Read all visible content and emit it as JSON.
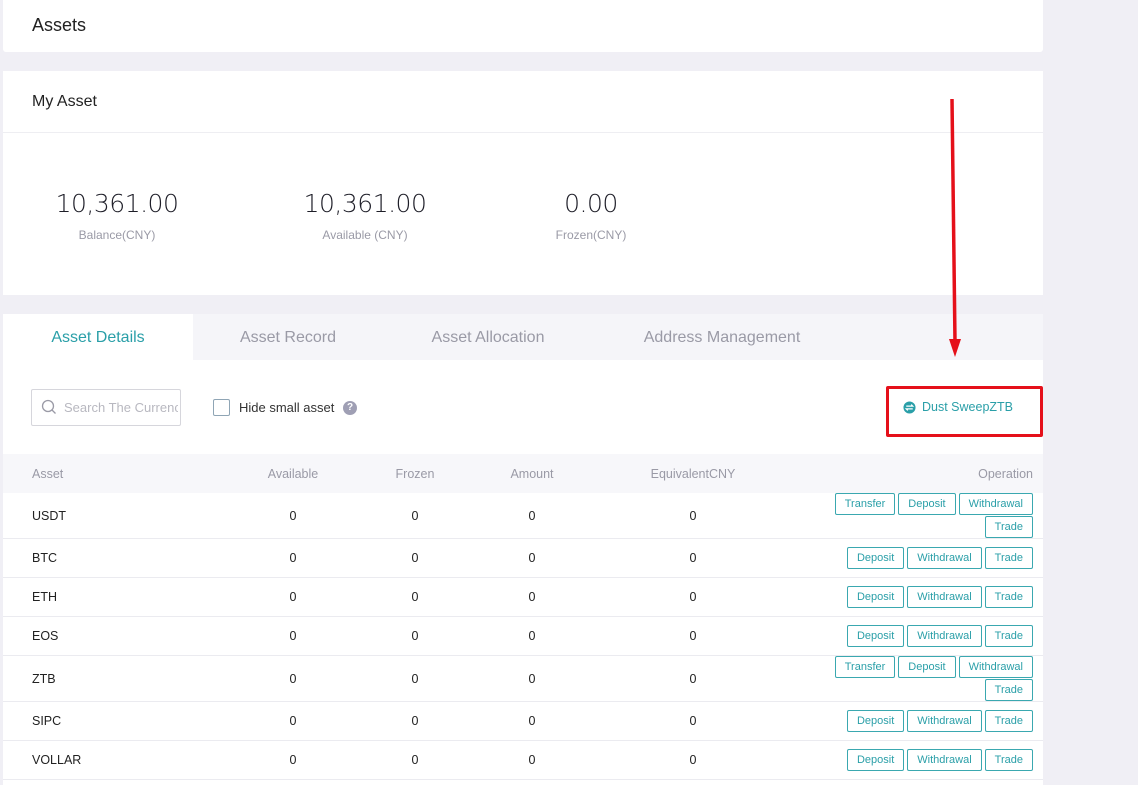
{
  "header": {
    "title": "Assets"
  },
  "my_asset": {
    "title": "My Asset",
    "stats": [
      {
        "value": "10,361.00",
        "label": "Balance(CNY)"
      },
      {
        "value": "10,361.00",
        "label": "Available (CNY)"
      },
      {
        "value": "0.00",
        "label": "Frozen(CNY)"
      }
    ]
  },
  "tabs": [
    {
      "label": "Asset Details",
      "active": true
    },
    {
      "label": "Asset Record",
      "active": false
    },
    {
      "label": "Asset Allocation",
      "active": false
    },
    {
      "label": "Address Management",
      "active": false
    }
  ],
  "toolbar": {
    "search_placeholder": "Search The Currency",
    "search_value": "",
    "hide_small_label": "Hide small asset",
    "hide_small_checked": false,
    "help_icon": "question-circle-icon",
    "dust_sweep_label": "Dust SweepZTB",
    "dust_sweep_icon": "exchange-circle-icon"
  },
  "colors": {
    "accent": "#2a9fa8",
    "annotation": "#e5101a",
    "background": "#f0eff5"
  },
  "table": {
    "columns": [
      "Asset",
      "Available",
      "Frozen",
      "Amount",
      "EquivalentCNY",
      "Operation"
    ],
    "rows": [
      {
        "asset": "USDT",
        "available": "0",
        "frozen": "0",
        "amount": "0",
        "equivalent": "0",
        "ops": [
          "Transfer",
          "Deposit",
          "Withdrawal",
          "Trade"
        ]
      },
      {
        "asset": "BTC",
        "available": "0",
        "frozen": "0",
        "amount": "0",
        "equivalent": "0",
        "ops": [
          "Deposit",
          "Withdrawal",
          "Trade"
        ]
      },
      {
        "asset": "ETH",
        "available": "0",
        "frozen": "0",
        "amount": "0",
        "equivalent": "0",
        "ops": [
          "Deposit",
          "Withdrawal",
          "Trade"
        ]
      },
      {
        "asset": "EOS",
        "available": "0",
        "frozen": "0",
        "amount": "0",
        "equivalent": "0",
        "ops": [
          "Deposit",
          "Withdrawal",
          "Trade"
        ]
      },
      {
        "asset": "ZTB",
        "available": "0",
        "frozen": "0",
        "amount": "0",
        "equivalent": "0",
        "ops": [
          "Transfer",
          "Deposit",
          "Withdrawal",
          "Trade"
        ]
      },
      {
        "asset": "SIPC",
        "available": "0",
        "frozen": "0",
        "amount": "0",
        "equivalent": "0",
        "ops": [
          "Deposit",
          "Withdrawal",
          "Trade"
        ]
      },
      {
        "asset": "VOLLAR",
        "available": "0",
        "frozen": "0",
        "amount": "0",
        "equivalent": "0",
        "ops": [
          "Deposit",
          "Withdrawal",
          "Trade"
        ]
      }
    ]
  }
}
